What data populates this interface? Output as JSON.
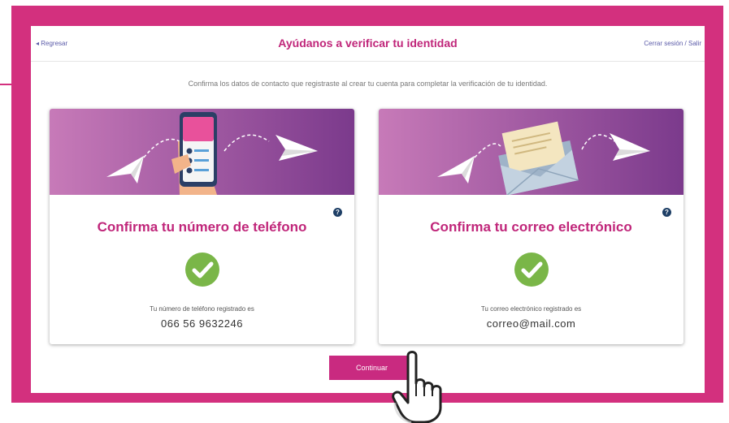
{
  "header": {
    "back_link": "◂ Regresar",
    "title": "Ayúdanos a verificar tu identidad",
    "logout_link": "Cerrar sesión / Salir"
  },
  "instruction": "Confirma los datos de contacto que registraste al crear tu cuenta para completar la verificación de tu identidad.",
  "cards": [
    {
      "title": "Confirma tu número de teléfono",
      "label": "Tu número de teléfono registrado es",
      "value": "066 56 9632246"
    },
    {
      "title": "Confirma tu correo electrónico",
      "label": "Tu correo electrónico registrado es",
      "value": "correo@mail.com"
    }
  ],
  "next_button": "Continuar",
  "colors": {
    "frame": "#d3307e",
    "title": "#c0267a",
    "banner_start": "#c77ab8",
    "banner_end": "#7b3a8c",
    "check": "#7ab648",
    "help_icon": "#1e3f66"
  },
  "icons": [
    "paper-plane-icon",
    "smartphone-icon",
    "envelope-icon",
    "check-circle-icon",
    "help-icon",
    "hand-pointer-icon"
  ]
}
